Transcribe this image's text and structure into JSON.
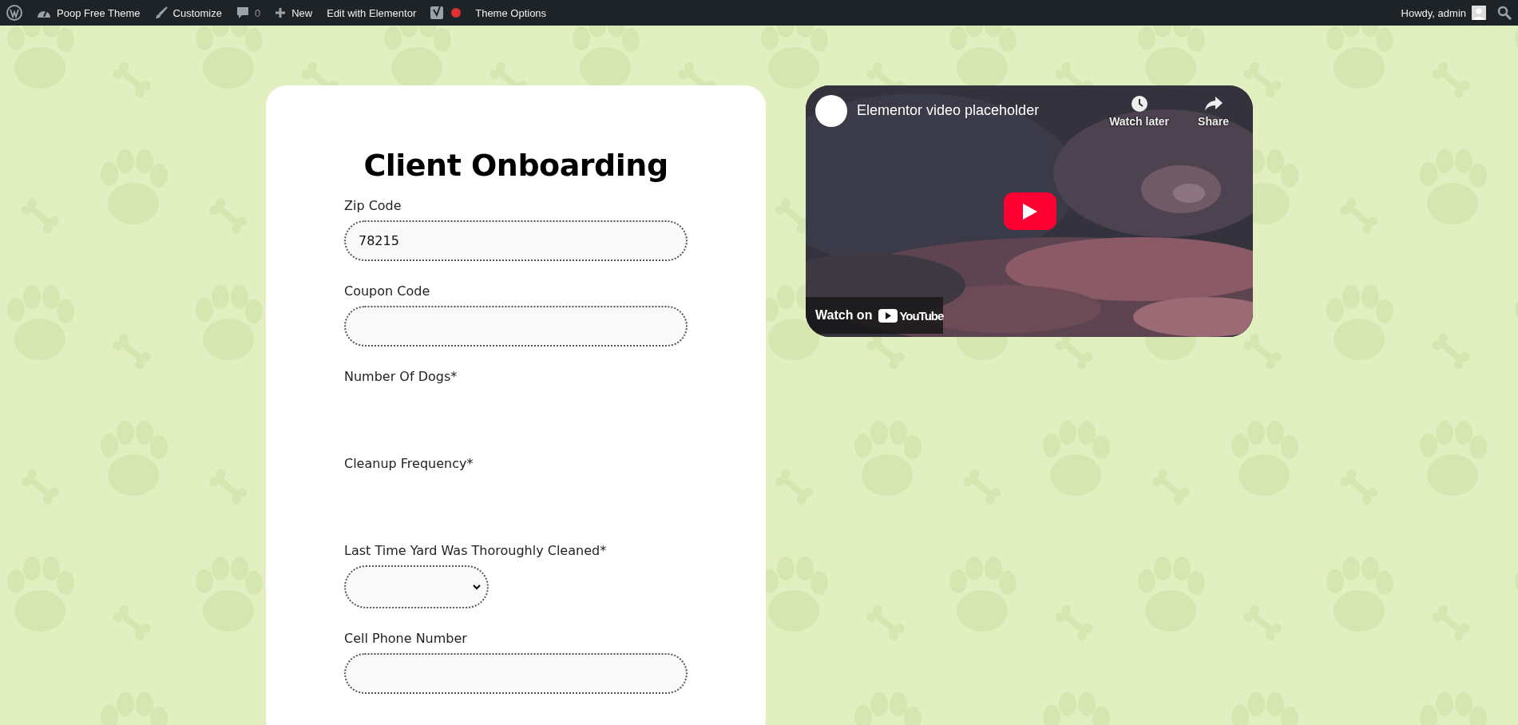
{
  "admin_bar": {
    "items": [
      {
        "kind": "wp"
      },
      {
        "kind": "site",
        "label": "Poop Free Theme"
      },
      {
        "kind": "brush",
        "label": "Customize"
      },
      {
        "kind": "comments",
        "label": "0"
      },
      {
        "kind": "new",
        "label": "New"
      },
      {
        "kind": "plain",
        "label": "Edit with Elementor"
      },
      {
        "kind": "seo",
        "color": "#dc3232"
      },
      {
        "kind": "plain",
        "label": "Theme Options"
      }
    ],
    "account": {
      "label": "Howdy, admin"
    }
  },
  "form": {
    "title": "Client Onboarding",
    "fields": [
      {
        "kind": "text",
        "label": "Zip Code",
        "value": "78215"
      },
      {
        "kind": "text",
        "label": "Coupon Code"
      },
      {
        "kind": "blank",
        "label": "Number Of Dogs*"
      },
      {
        "kind": "blank",
        "label": "Cleanup Frequency*"
      },
      {
        "kind": "select",
        "label": "Last Time Yard Was Thoroughly Cleaned*"
      },
      {
        "kind": "text",
        "label": "Cell Phone Number"
      }
    ]
  },
  "video": {
    "title": "Elementor video placeholder",
    "actions": [
      {
        "kind": "clock",
        "label": "Watch later"
      },
      {
        "kind": "share",
        "label": "Share"
      }
    ],
    "watch_on": "Watch on",
    "brand": "YouTube"
  }
}
